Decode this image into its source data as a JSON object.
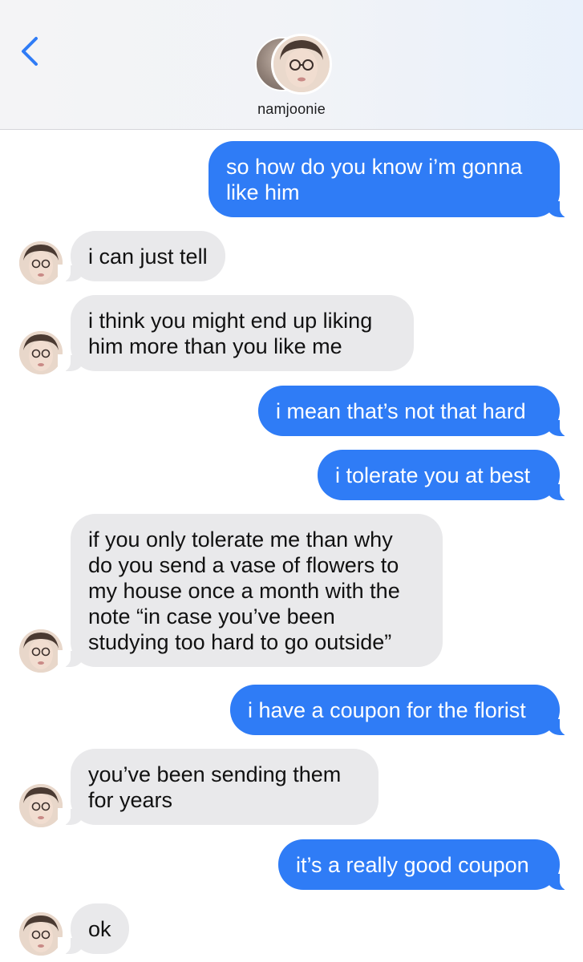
{
  "header": {
    "contact_name": "namjoonie",
    "back_icon": "chevron-left-icon",
    "accent_color": "#2f7cf6"
  },
  "messages": [
    {
      "direction": "sent",
      "lines": [
        "so how do you know i’m gonna",
        "like him"
      ]
    },
    {
      "direction": "received",
      "lines": [
        "i can just tell"
      ]
    },
    {
      "direction": "received",
      "lines": [
        "i think you might end up liking",
        "him more than you like me"
      ]
    },
    {
      "direction": "sent",
      "lines": [
        "i mean that’s not that hard"
      ]
    },
    {
      "direction": "sent",
      "lines": [
        "i tolerate you at best"
      ]
    },
    {
      "direction": "received",
      "lines": [
        "if you only tolerate me than why",
        "do you send a vase of flowers to",
        "my house once a month with the",
        "note “in case you’ve been",
        "studying too hard to go outside”"
      ]
    },
    {
      "direction": "sent",
      "lines": [
        "i have a coupon for the florist"
      ]
    },
    {
      "direction": "received",
      "lines": [
        "you’ve been sending them",
        "for years"
      ]
    },
    {
      "direction": "sent",
      "lines": [
        "it’s a really good coupon"
      ]
    },
    {
      "direction": "received",
      "lines": [
        "ok"
      ]
    }
  ]
}
